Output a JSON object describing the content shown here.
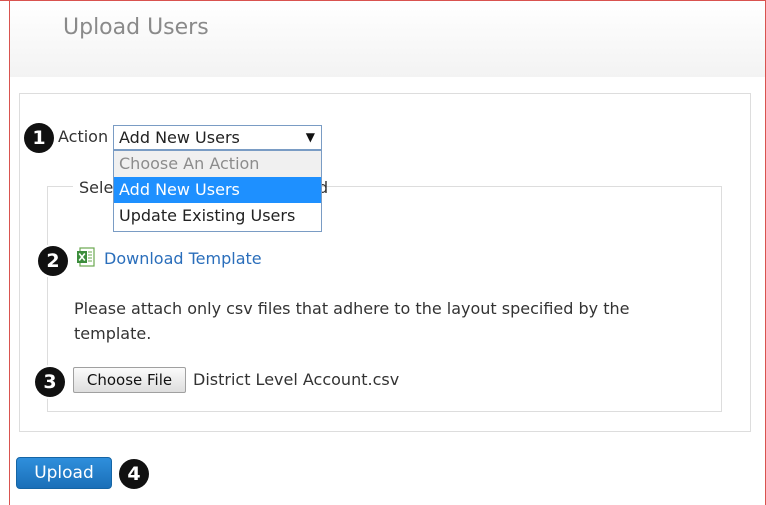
{
  "header": {
    "title": "Upload Users"
  },
  "action": {
    "label": "Action",
    "selected_value": "Add New Users",
    "options": [
      "Choose An Action",
      "Add New Users",
      "Update Existing Users"
    ]
  },
  "fieldset": {
    "legend_start": "Sele",
    "legend_end": "d"
  },
  "template": {
    "link_label": "Download Template",
    "icon": "excel-file-icon"
  },
  "help_text": "Please attach only csv files that adhere to the layout specified by the template.",
  "file": {
    "button_label": "Choose File",
    "selected_file": "District Level Account.csv"
  },
  "upload": {
    "button_label": "Upload"
  },
  "callouts": [
    "1",
    "2",
    "3",
    "4"
  ],
  "colors": {
    "link": "#2a6ebb",
    "selected_option": "#1e90ff",
    "upload_button": "#1a6fb8",
    "callout": "#111111"
  }
}
